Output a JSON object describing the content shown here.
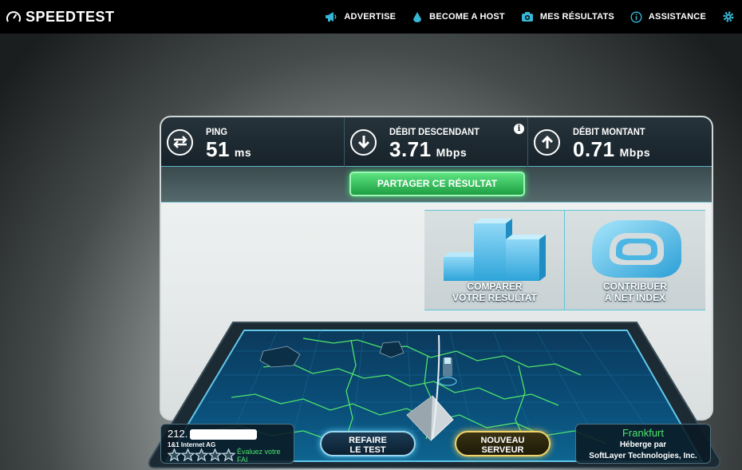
{
  "brand": {
    "name": "SPEEDTEST"
  },
  "nav": [
    {
      "label": "ADVERTISE",
      "icon": "megaphone-icon"
    },
    {
      "label": "BECOME A HOST",
      "icon": "drop-icon"
    },
    {
      "label": "MES RÉSULTATS",
      "icon": "camera-icon"
    },
    {
      "label": "ASSISTANCE",
      "icon": "info-icon"
    }
  ],
  "settings_icon": "gear-icon",
  "results": {
    "ping": {
      "label": "PING",
      "value": "51",
      "unit": "ms"
    },
    "download": {
      "label": "DÉBIT DESCENDANT",
      "value": "3.71",
      "unit": "Mbps"
    },
    "upload": {
      "label": "DÉBIT MONTANT",
      "value": "0.71",
      "unit": "Mbps"
    }
  },
  "share": {
    "label": "PARTAGER CE RÉSULTAT"
  },
  "tiles": {
    "compare": {
      "line1": "COMPARER",
      "line2": "VOTRE RÉSULTAT"
    },
    "netindex": {
      "line1": "CONTRIBUER",
      "line2": "À NET INDEX"
    }
  },
  "client": {
    "ip": "212.",
    "isp": "1&1 Internet AG",
    "rate_text": "Évaluez votre FAI",
    "stars": 5
  },
  "buttons": {
    "retest_line1": "REFAIRE",
    "retest_line2": "LE TEST",
    "newserver_line1": "NOUVEAU",
    "newserver_line2": "SERVEUR"
  },
  "server": {
    "city": "Frankfurt",
    "host_line1": "Héberge par",
    "host_line2": "SoftLayer Technologies, Inc."
  },
  "colors": {
    "accent_blue": "#2fb6d6",
    "share_green": "#2fc45a",
    "map_border": "#5fc5e6",
    "newserver_gold": "#e7c44a"
  }
}
